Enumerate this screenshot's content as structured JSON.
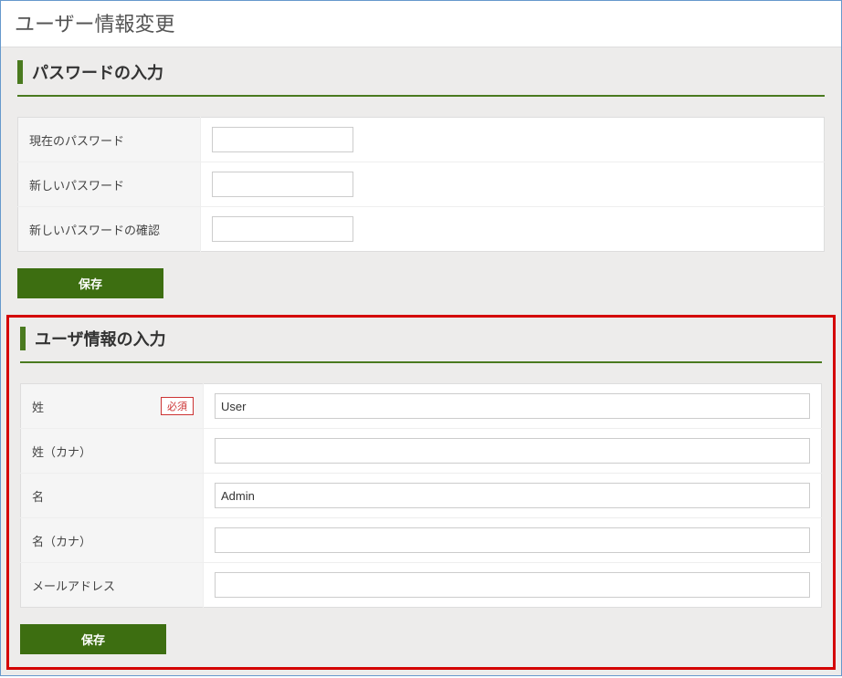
{
  "page_title": "ユーザー情報変更",
  "password_section": {
    "title": "パスワードの入力",
    "rows": {
      "current": {
        "label": "現在のパスワード",
        "value": ""
      },
      "new": {
        "label": "新しいパスワード",
        "value": ""
      },
      "confirm": {
        "label": "新しいパスワードの確認",
        "value": ""
      }
    },
    "save_label": "保存"
  },
  "user_section": {
    "title": "ユーザ情報の入力",
    "required_badge": "必須",
    "rows": {
      "lastname": {
        "label": "姓",
        "value": "User",
        "required": true
      },
      "lastname_kana": {
        "label": "姓（カナ）",
        "value": ""
      },
      "firstname": {
        "label": "名",
        "value": "Admin"
      },
      "firstname_kana": {
        "label": "名（カナ）",
        "value": ""
      },
      "email": {
        "label": "メールアドレス",
        "value": ""
      }
    },
    "save_label": "保存"
  }
}
